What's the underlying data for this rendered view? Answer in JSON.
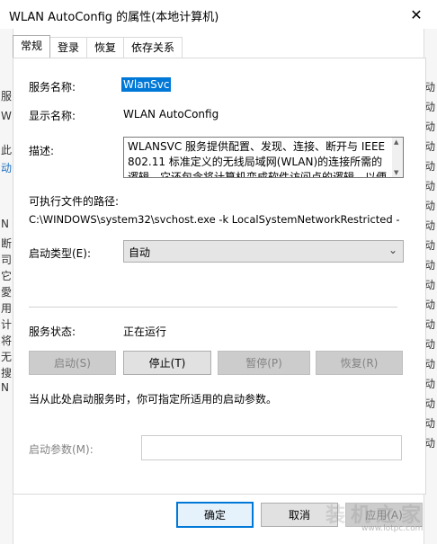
{
  "window": {
    "title": "WLAN AutoConfig 的属性(本地计算机)",
    "close_glyph": "✕"
  },
  "tabs": [
    {
      "label": "常规",
      "active": true
    },
    {
      "label": "登录",
      "active": false
    },
    {
      "label": "恢复",
      "active": false
    },
    {
      "label": "依存关系",
      "active": false
    }
  ],
  "general": {
    "service_name_label": "服务名称:",
    "service_name_value": "WlanSvc",
    "display_name_label": "显示名称:",
    "display_name_value": "WLAN AutoConfig",
    "description_label": "描述:",
    "description_lines": [
      "WLANSVC 服务提供配置、发现、连接、断开与 IEEE",
      "802.11 标准定义的无线局域网(WLAN)的连接所需的",
      "逻辑。它还包含将计算机变成软件访问点的逻辑，以便"
    ],
    "exe_path_label": "可执行文件的路径:",
    "exe_path_value": "C:\\WINDOWS\\system32\\svchost.exe -k LocalSystemNetworkRestricted -",
    "startup_type_label": "启动类型(E):",
    "startup_type_value": "自动",
    "status_label": "服务状态:",
    "status_value": "正在运行",
    "buttons": {
      "start": "启动(S)",
      "stop": "停止(T)",
      "pause": "暂停(P)",
      "resume": "恢复(R)"
    },
    "hint": "当从此处启动服务时，你可指定所适用的启动参数。",
    "start_params_label": "启动参数(M):",
    "start_params_value": ""
  },
  "footer": {
    "ok": "确定",
    "cancel": "取消",
    "apply": "应用(A)"
  },
  "watermark": {
    "text": "装机之家",
    "url": "www.lotpc.com"
  },
  "background_left_glyphs": [
    "服",
    "W",
    "此",
    "动",
    "N",
    "断",
    "司",
    "它",
    "愛",
    "用",
    "计",
    "将",
    "无",
    "搜",
    "N"
  ],
  "background_right_glyphs": [
    "动",
    "动",
    "动",
    "动",
    "动",
    "动",
    "动",
    "动",
    "动",
    "动",
    "动",
    "动",
    "动",
    "动",
    "动",
    "动",
    "动",
    "动",
    "动"
  ],
  "colors": {
    "accent": "#0078d7",
    "button_face": "#e1e1e1",
    "disabled_text": "#838383"
  }
}
